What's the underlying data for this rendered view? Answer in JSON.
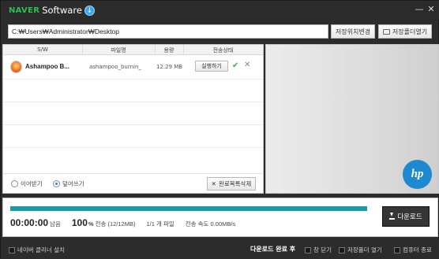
{
  "titlebar": {
    "brand_naver": "NAVER",
    "brand_software": "Software",
    "minimize_glyph": "—",
    "close_glyph": "✕"
  },
  "path": {
    "value": "C:₩Users₩Administrator₩Desktop",
    "change_label": "저장위치변경",
    "open_folder_label": "저장폴더열기"
  },
  "table": {
    "headers": [
      "S/W",
      "파일명",
      "용량",
      "전송상태"
    ],
    "rows": [
      {
        "app_name": "Ashampoo B...",
        "file_name": "ashampoo_burnin_",
        "size": "12.29 MB",
        "run_label": "실행하기",
        "status_icon": "check-icon"
      }
    ]
  },
  "options": {
    "resume_label": "이어받기",
    "overwrite_label": "덮어쓰기",
    "selected": "overwrite",
    "clear_label": "완료목록삭제"
  },
  "ad": {
    "logo_text": "hp"
  },
  "progress": {
    "percent": 100,
    "time_remaining": "00:00:00",
    "remaining_label": "남음",
    "percent_text": "100",
    "percent_sign": "%",
    "transfer_text": "전송 (12/12MB)",
    "files_text": "1/1 개 파일",
    "speed_text": "전송 속도 0.00MB/s",
    "download_label": "다운로드"
  },
  "bottom": {
    "install_label": "네이버 클리너 설치",
    "after_label": "다운로드 완료 후",
    "close_label": "창 닫기",
    "open_folder_label": "저장폴더 열기",
    "shutdown_label": "컴퓨터 종료"
  },
  "colors": {
    "accent_progress": "#1a9aa6",
    "naver_green": "#2ac04f",
    "status_ok": "#36b24a",
    "hp_blue": "#1e88d0"
  }
}
